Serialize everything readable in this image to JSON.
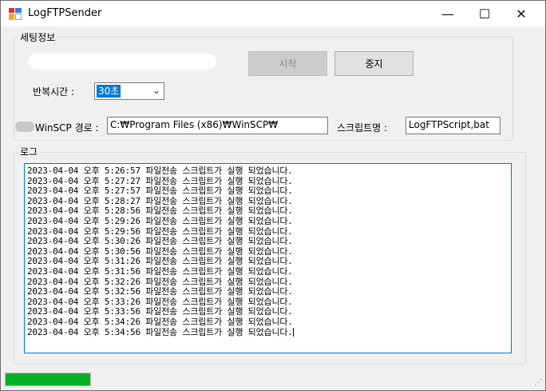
{
  "window": {
    "title": "LogFTPSender",
    "minimize_glyph": "—",
    "maximize_glyph": "☐",
    "close_glyph": "✕"
  },
  "settings": {
    "legend": "세팅정보",
    "start_label": "시작",
    "stop_label": "중지",
    "repeat_label": "반복시간 :",
    "repeat_value": "30초",
    "winscp_label": "WinSCP 경로 :",
    "winscp_path": "C:₩Program Files (x86)₩WinSCP₩",
    "script_label": "스크립트명 :",
    "script_name": "LogFTPScript,bat"
  },
  "log": {
    "legend": "로그",
    "lines": [
      "2023-04-04 오후 5:26:57 파일전송 스크립트가 실행 되었습니다.",
      "2023-04-04 오후 5:27:27 파일전송 스크립트가 실행 되었습니다.",
      "2023-04-04 오후 5:27:57 파일전송 스크립트가 실행 되었습니다.",
      "2023-04-04 오후 5:28:27 파일전송 스크립트가 실행 되었습니다.",
      "2023-04-04 오후 5:28:56 파일전송 스크립트가 실행 되었습니다.",
      "2023-04-04 오후 5:29:26 파일전송 스크립트가 실행 되었습니다.",
      "2023-04-04 오후 5:29:56 파일전송 스크립트가 실행 되었습니다.",
      "2023-04-04 오후 5:30:26 파일전송 스크립트가 실행 되었습니다.",
      "2023-04-04 오후 5:30:56 파일전송 스크립트가 실행 되었습니다.",
      "2023-04-04 오후 5:31:26 파일전송 스크립트가 실행 되었습니다.",
      "2023-04-04 오후 5:31:56 파일전송 스크립트가 실행 되었습니다.",
      "2023-04-04 오후 5:32:26 파일전송 스크립트가 실행 되었습니다.",
      "2023-04-04 오후 5:32:56 파일전송 스크립트가 실행 되었습니다.",
      "2023-04-04 오후 5:33:26 파일전송 스크립트가 실행 되었습니다.",
      "2023-04-04 오후 5:33:56 파일전송 스크립트가 실행 되었습니다.",
      "2023-04-04 오후 5:34:26 파일전송 스크립트가 실행 되었습니다.",
      "2023-04-04 오후 5:34:56 파일전송 스크립트가 실행 되었습니다."
    ]
  },
  "status": {
    "progress_fraction": 1.0,
    "progress_color": "#06b025"
  },
  "icons": {
    "app": "app-window-icon",
    "grip": "resize-grip-icon"
  }
}
